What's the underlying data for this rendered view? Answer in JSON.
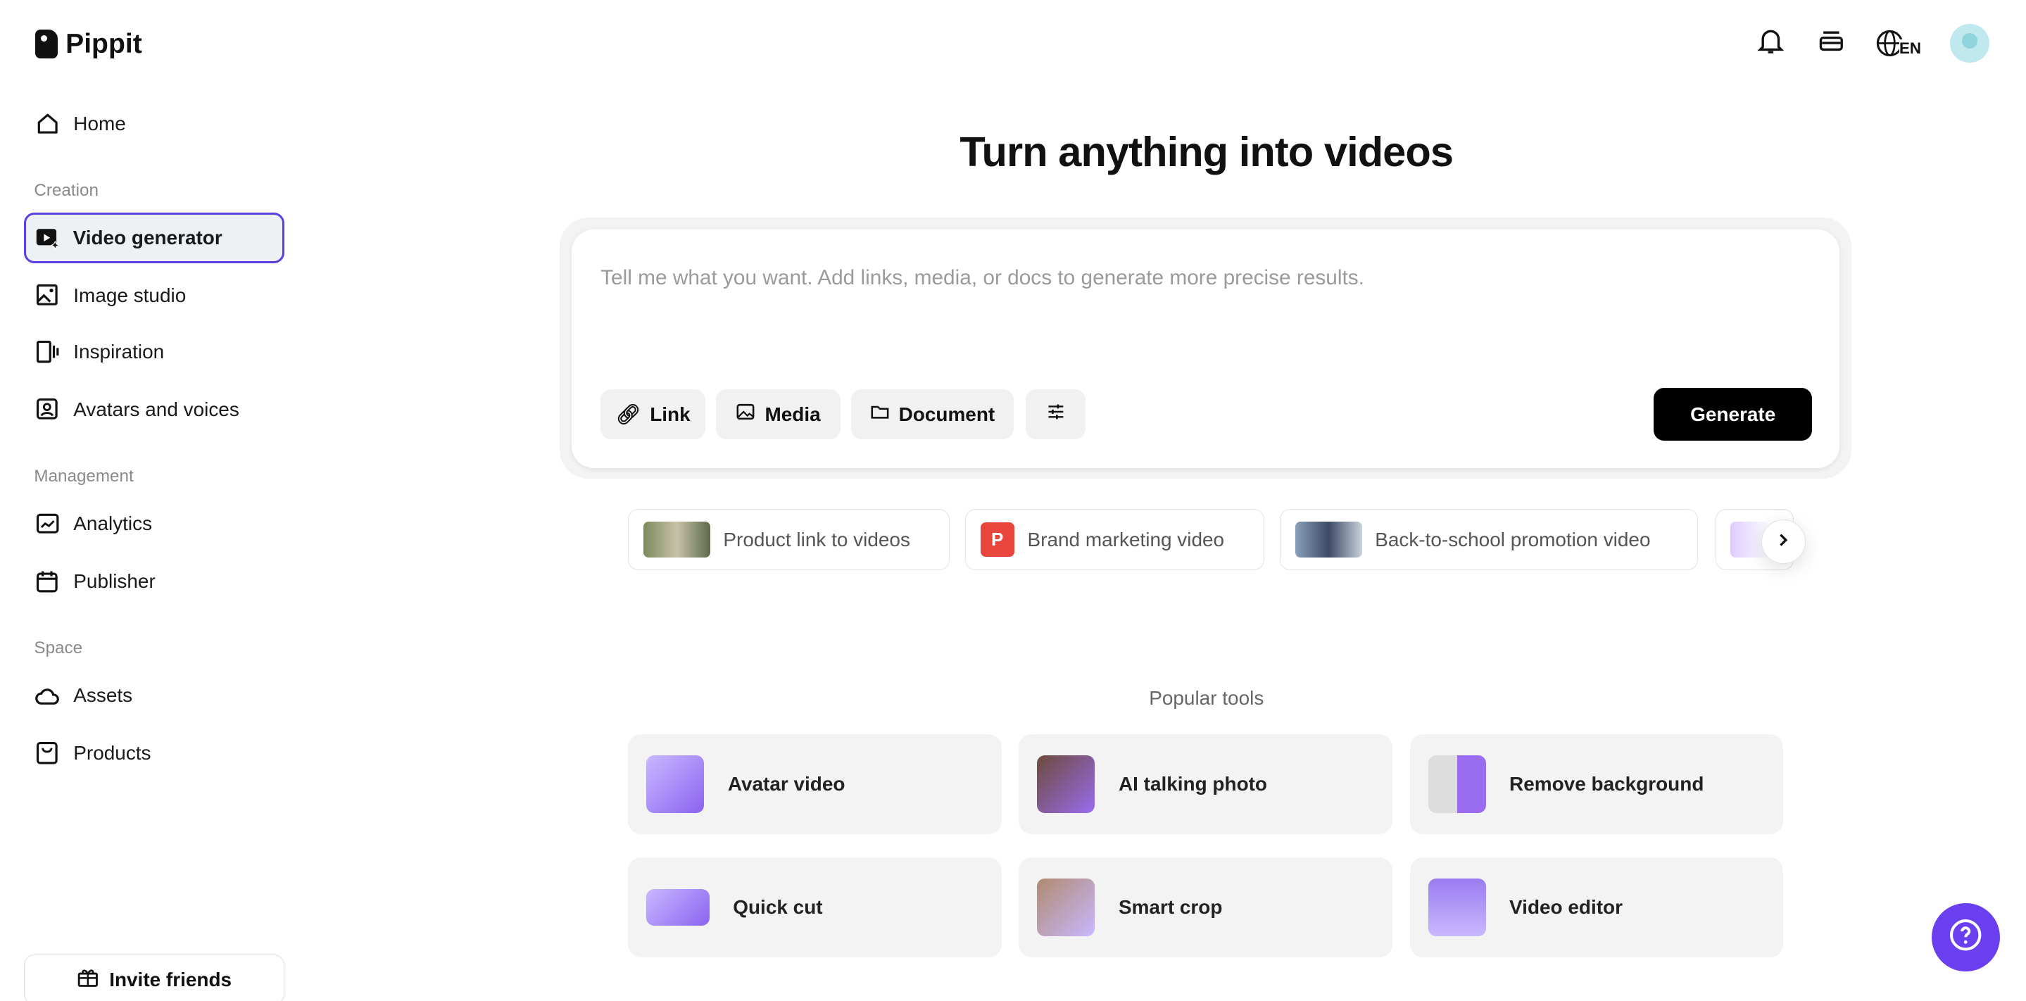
{
  "app": {
    "name": "Pippit"
  },
  "sidebar": {
    "home": "Home",
    "sections": {
      "creation": "Creation",
      "management": "Management",
      "space": "Space"
    },
    "items": [
      {
        "label": "Video generator",
        "icon": "video-sparkle-icon",
        "active": true
      },
      {
        "label": "Image studio",
        "icon": "image-icon"
      },
      {
        "label": "Inspiration",
        "icon": "inspiration-icon"
      },
      {
        "label": "Avatars and voices",
        "icon": "avatar-icon"
      },
      {
        "label": "Analytics",
        "icon": "chart-icon"
      },
      {
        "label": "Publisher",
        "icon": "calendar-icon"
      },
      {
        "label": "Assets",
        "icon": "cloud-icon"
      },
      {
        "label": "Products",
        "icon": "bag-icon"
      }
    ],
    "invite": "Invite friends"
  },
  "header": {
    "language": "EN"
  },
  "main": {
    "title": "Turn anything into videos",
    "prompt_placeholder": "Tell me what you want. Add links, media, or docs to generate more precise results.",
    "chips": [
      "Link",
      "Media",
      "Document"
    ],
    "generate": "Generate",
    "suggestions": [
      "Product link to videos",
      "Brand marketing video",
      "Back-to-school promotion video"
    ],
    "brand_badge": "P",
    "popular_title": "Popular tools",
    "tools": [
      "Avatar video",
      "AI talking photo",
      "Remove background",
      "Quick cut",
      "Smart crop",
      "Video editor"
    ]
  },
  "colors": {
    "accent": "#5b3fe0",
    "help": "#6a3ff0"
  }
}
